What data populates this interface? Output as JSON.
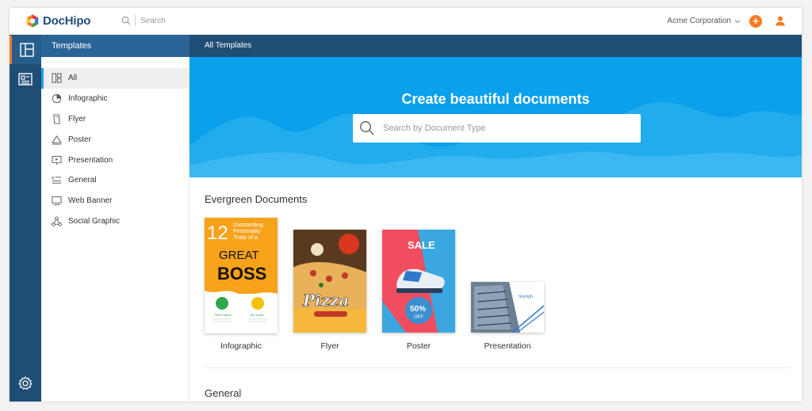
{
  "app": {
    "name": "DocHipo"
  },
  "topbar": {
    "search_placeholder": "Search",
    "organization": "Acme Corporation",
    "add_label": "+"
  },
  "sidebar": {
    "header": "Templates",
    "items": [
      {
        "label": "All",
        "icon": "grid-layout-icon",
        "active": true
      },
      {
        "label": "Infographic",
        "icon": "pie-chart-icon"
      },
      {
        "label": "Flyer",
        "icon": "flyer-icon"
      },
      {
        "label": "Poster",
        "icon": "poster-icon"
      },
      {
        "label": "Presentation",
        "icon": "presentation-icon"
      },
      {
        "label": "General",
        "icon": "text-lines-icon"
      },
      {
        "label": "Web Banner",
        "icon": "monitor-icon"
      },
      {
        "label": "Social Graphic",
        "icon": "share-icon"
      }
    ]
  },
  "main": {
    "header": "All Templates",
    "hero": {
      "title": "Create beautiful documents",
      "search_placeholder": "Search by Document Type"
    },
    "sections": [
      {
        "title": "Evergreen Documents",
        "cards": [
          {
            "label": "Infographic",
            "thumb": {
              "line1": "12",
              "line2": "Outstanding",
              "line3": "Personality",
              "line4": "Traits of a",
              "line5": "GREAT",
              "line6": "BOSS",
              "caption1": "Think Positive",
              "caption2": "Be Honest"
            }
          },
          {
            "label": "Flyer",
            "thumb": {
              "title": "Pizza"
            }
          },
          {
            "label": "Poster",
            "thumb": {
              "title": "SALE",
              "discount": "50%",
              "off": "OFF"
            }
          },
          {
            "label": "Presentation",
            "thumb": {
              "brand": "Skyhigh"
            }
          }
        ]
      },
      {
        "title": "General"
      }
    ]
  },
  "colors": {
    "brand_dark": "#1f4d75",
    "brand_mid": "#2a6395",
    "hero_blue": "#0ba0ec",
    "accent_orange": "#f57c20"
  }
}
